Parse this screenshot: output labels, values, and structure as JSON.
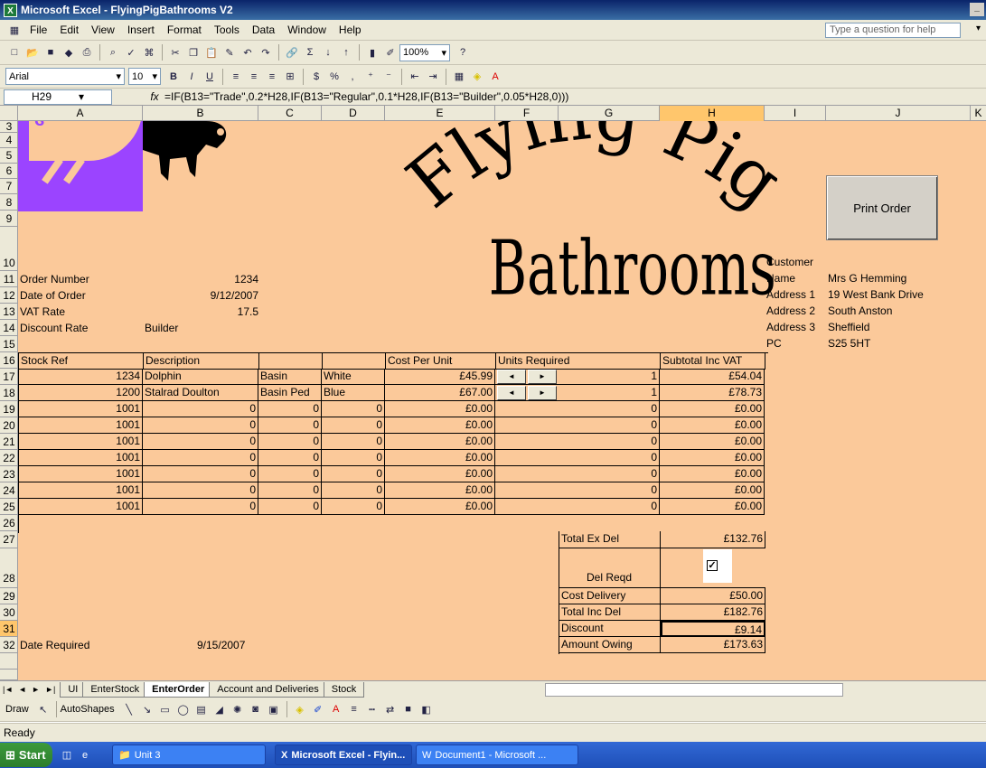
{
  "window": {
    "title": "Microsoft Excel - FlyingPigBathrooms V2"
  },
  "menu": {
    "items": [
      "File",
      "Edit",
      "View",
      "Insert",
      "Format",
      "Tools",
      "Data",
      "Window",
      "Help"
    ],
    "ask_placeholder": "Type a question for help"
  },
  "toolbar": {
    "zoom": "100%",
    "font_name": "Arial",
    "font_size": "10"
  },
  "formula_bar": {
    "name_box": "H29",
    "fx": "fx",
    "formula": "=IF(B13=\"Trade\",0.2*H28,IF(B13=\"Regular\",0.1*H28,IF(B13=\"Builder\",0.05*H28,0)))"
  },
  "columns": [
    "A",
    "B",
    "C",
    "D",
    "E",
    "F",
    "G",
    "H",
    "I",
    "J",
    "K"
  ],
  "rows": [
    "3",
    "4",
    "5",
    "6",
    "7",
    "8",
    "9",
    "10",
    "11",
    "12",
    "13",
    "14",
    "15",
    "16",
    "17",
    "18",
    "19",
    "20",
    "21",
    "22",
    "23",
    "24",
    "25",
    "26",
    "27",
    "28",
    "29",
    "30",
    "31",
    "32"
  ],
  "logo": {
    "line1": "Flying Pig",
    "line2": "Bathrooms"
  },
  "print_button": "Print Order",
  "order": {
    "number_label": "Order Number",
    "number": "1234",
    "date_label": "Date of Order",
    "date": "9/12/2007",
    "vat_label": "VAT Rate",
    "vat": "17.5",
    "discount_label": "Discount Rate",
    "discount": "Builder"
  },
  "customer": {
    "heading": "Customer",
    "name_label": "Name",
    "name": "Mrs G Hemming",
    "addr1_label": "Address 1",
    "addr1": "19 West Bank Drive",
    "addr2_label": "Address 2",
    "addr2": "South Anston",
    "addr3_label": "Address 3",
    "addr3": "Sheffield",
    "pc_label": "PC",
    "pc": "S25 5HT"
  },
  "table": {
    "headers": {
      "stock_ref": "Stock Ref",
      "description": "Description",
      "cost": "Cost Per Unit",
      "units": "Units Required",
      "subtotal": "Subtotal Inc VAT"
    },
    "rows": [
      {
        "ref": "1234",
        "b": "Dolphin",
        "c": "Basin",
        "d": "White",
        "cost": "£45.99",
        "units": "1",
        "subtotal": "£54.04"
      },
      {
        "ref": "1200",
        "b": "Stalrad Doulton",
        "c": "Basin Ped",
        "d": "Blue",
        "cost": "£67.00",
        "units": "1",
        "subtotal": "£78.73"
      },
      {
        "ref": "1001",
        "b": "0",
        "c": "0",
        "d": "0",
        "cost": "£0.00",
        "units": "0",
        "subtotal": "£0.00"
      },
      {
        "ref": "1001",
        "b": "0",
        "c": "0",
        "d": "0",
        "cost": "£0.00",
        "units": "0",
        "subtotal": "£0.00"
      },
      {
        "ref": "1001",
        "b": "0",
        "c": "0",
        "d": "0",
        "cost": "£0.00",
        "units": "0",
        "subtotal": "£0.00"
      },
      {
        "ref": "1001",
        "b": "0",
        "c": "0",
        "d": "0",
        "cost": "£0.00",
        "units": "0",
        "subtotal": "£0.00"
      },
      {
        "ref": "1001",
        "b": "0",
        "c": "0",
        "d": "0",
        "cost": "£0.00",
        "units": "0",
        "subtotal": "£0.00"
      },
      {
        "ref": "1001",
        "b": "0",
        "c": "0",
        "d": "0",
        "cost": "£0.00",
        "units": "0",
        "subtotal": "£0.00"
      },
      {
        "ref": "1001",
        "b": "0",
        "c": "0",
        "d": "0",
        "cost": "£0.00",
        "units": "0",
        "subtotal": "£0.00"
      }
    ]
  },
  "totals": {
    "total_ex_del_label": "Total Ex Del",
    "total_ex_del": "£132.76",
    "del_reqd_label": "Del Reqd",
    "cost_delivery_label": "Cost Delivery",
    "cost_delivery": "£50.00",
    "total_inc_del_label": "Total Inc Del",
    "total_inc_del": "£182.76",
    "discount_label": "Discount",
    "discount": "£9.14",
    "amount_owing_label": "Amount Owing",
    "amount_owing": "£173.63"
  },
  "date_required": {
    "label": "Date Required",
    "value": "9/15/2007"
  },
  "tabs": [
    "UI",
    "EnterStock",
    "EnterOrder",
    "Account and Deliveries",
    "Stock"
  ],
  "active_tab": "EnterOrder",
  "draw": {
    "draw_label": "Draw",
    "autoshapes_label": "AutoShapes"
  },
  "status": "Ready",
  "taskbar": {
    "start": "Start",
    "unit": "Unit 3",
    "excel": "Microsoft Excel - Flyin...",
    "word": "Document1 - Microsoft ..."
  }
}
